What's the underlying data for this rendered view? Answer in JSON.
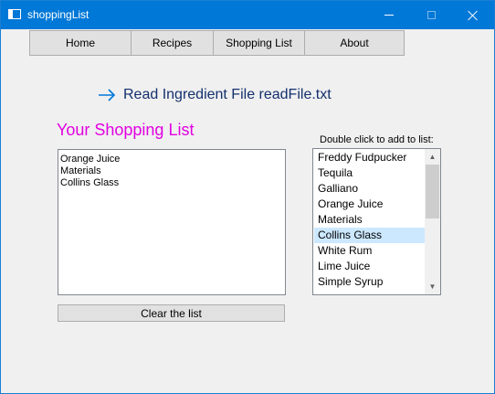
{
  "window": {
    "title": "shoppingList"
  },
  "nav": {
    "home": "Home",
    "recipes": "Recipes",
    "shopping_list": "Shopping List",
    "about": "About"
  },
  "read_link": {
    "icon": "arrow-right-icon",
    "label": "Read Ingredient File readFile.txt"
  },
  "heading": "Your Shopping List",
  "hint": "Double click to add to list:",
  "shopping_list": [
    "Orange Juice",
    "Materials",
    "Collins Glass"
  ],
  "ingredients": {
    "items": [
      "Freddy Fudpucker",
      "Tequila",
      "Galliano",
      "Orange Juice",
      "Materials",
      "Collins Glass",
      "White Rum",
      "Lime Juice",
      "Simple Syrup"
    ],
    "selected": "Collins Glass"
  },
  "clear_button": "Clear the list",
  "colors": {
    "titlebar": "#0078d7",
    "heading": "#e100e1",
    "link_text": "#13306d",
    "arrow": "#0078d7",
    "selection": "#cce8ff"
  }
}
